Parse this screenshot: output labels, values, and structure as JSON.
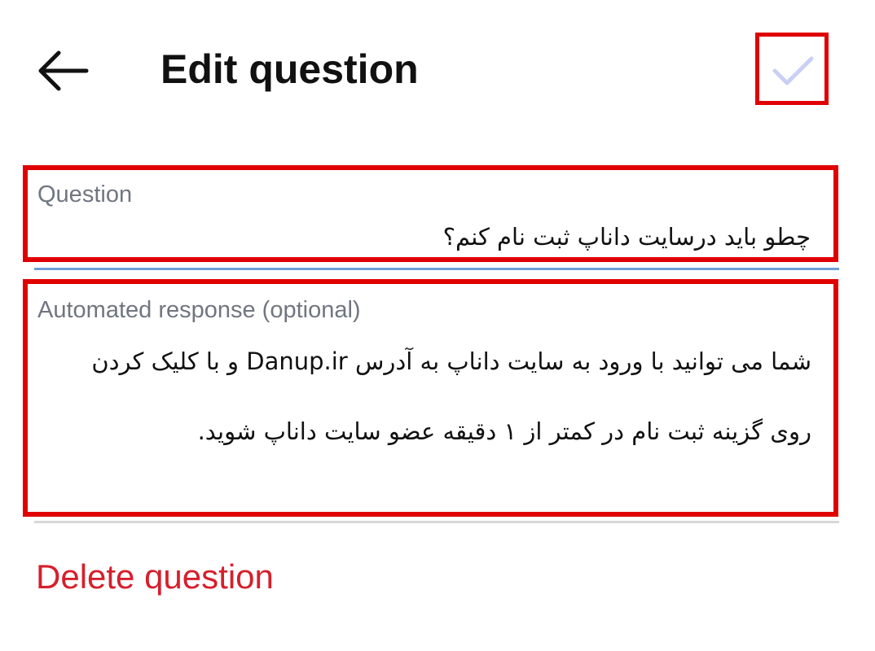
{
  "header": {
    "back_icon": "arrow-left-icon",
    "title": "Edit question",
    "save_icon": "checkmark-icon",
    "highlight_color": "#e00000",
    "save_icon_color": "#c9d0f4"
  },
  "form": {
    "question": {
      "label": "Question",
      "value": "چطو باید درسایت داناپ ثبت نام کنم؟"
    },
    "automated_response": {
      "label": "Automated response (optional)",
      "value": "شما می توانید با ورود به سایت داناپ به آدرس Danup.ir و با کلیک کردن روی گزینه ثبت نام در کمتر از ۱ دقیقه عضو سایت داناپ شوید."
    }
  },
  "actions": {
    "delete_label": "Delete question",
    "delete_color": "#d61f2c"
  }
}
